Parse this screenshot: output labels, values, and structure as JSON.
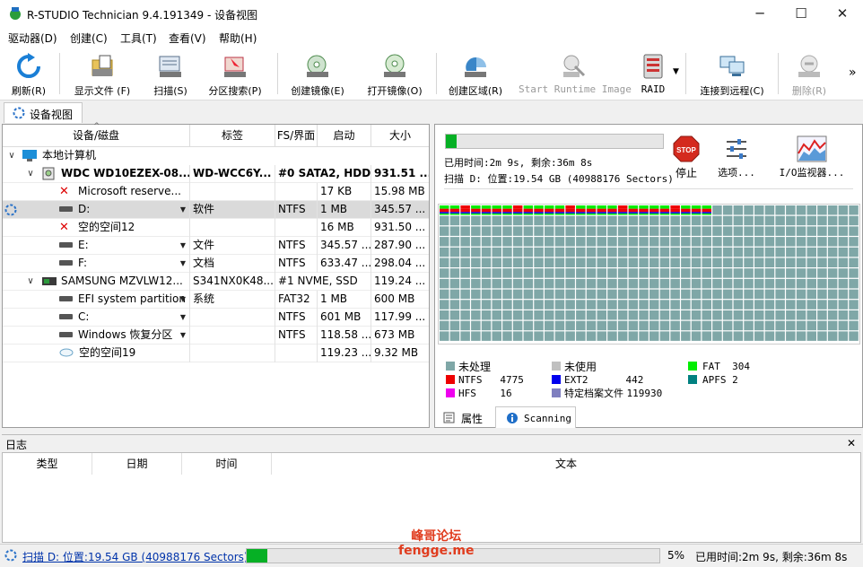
{
  "window": {
    "title": "R-STUDIO Technician 9.4.191349 - 设备视图",
    "minimize_glyph": "─",
    "maximize_glyph": "☐",
    "close_glyph": "✕"
  },
  "menu": [
    "驱动器(D)",
    "创建(C)",
    "工具(T)",
    "查看(V)",
    "帮助(H)"
  ],
  "toolbar": {
    "refresh": "刷新(R)",
    "show_files": "显示文件 (F)",
    "scan": "扫描(S)",
    "partition_search": "分区搜索(P)",
    "create_image": "创建镜像(E)",
    "open_image": "打开镜像(O)",
    "create_region": "创建区域(R)",
    "start_runtime": "Start Runtime Image",
    "raid": "RAID",
    "connect_remote": "连接到远程(C)",
    "delete": "删除(R)",
    "more": "»"
  },
  "view_tab": "设备视图",
  "tree": {
    "headers": [
      "设备/磁盘",
      "标签",
      "FS/界面",
      "启动",
      "大小"
    ],
    "root": "本地计算机",
    "rows": [
      {
        "name": "WDC WD10EZEX-08...",
        "label": "WD-WCC6Y...",
        "fs": "#0 SATA2, HDD",
        "start": "",
        "size": "931.51 ..."
      },
      {
        "name": "Microsoft reserve...",
        "label": "",
        "fs": "",
        "start": "17 KB",
        "size": "15.98 MB"
      },
      {
        "name": "D:",
        "label": "软件",
        "fs": "NTFS",
        "start": "1 MB",
        "size": "345.57 ..."
      },
      {
        "name": "空的空间12",
        "label": "",
        "fs": "",
        "start": "16 MB",
        "size": "931.50 ..."
      },
      {
        "name": "E:",
        "label": "文件",
        "fs": "NTFS",
        "start": "345.57 ...",
        "size": "287.90 ..."
      },
      {
        "name": "F:",
        "label": "文档",
        "fs": "NTFS",
        "start": "633.47 ...",
        "size": "298.04 ..."
      },
      {
        "name": "SAMSUNG MZVLW12...",
        "label": "S341NX0K48...",
        "fs": "#1 NVME, SSD",
        "start": "",
        "size": "119.24 ..."
      },
      {
        "name": "EFI system partition",
        "label": "系统",
        "fs": "FAT32",
        "start": "1 MB",
        "size": "600 MB"
      },
      {
        "name": "C:",
        "label": "",
        "fs": "NTFS",
        "start": "601 MB",
        "size": "117.99 ..."
      },
      {
        "name": "Windows 恢复分区",
        "label": "",
        "fs": "NTFS",
        "start": "118.58 ...",
        "size": "673 MB"
      },
      {
        "name": "空的空间19",
        "label": "",
        "fs": "",
        "start": "119.23 ...",
        "size": "9.32 MB"
      }
    ]
  },
  "scan": {
    "progress_fraction": 0.05,
    "line1": "已用时间:2m 9s, 剩余:36m 8s",
    "line2": "扫描 D: 位置:19.54 GB (40988176 Sectors)",
    "stop": "停止",
    "stop_sign": "STOP",
    "options": "选项...",
    "io_monitor": "I/O监视器...",
    "map_cells_total": 760,
    "map_cells_scanned": 26,
    "legend": [
      {
        "name": "未处理",
        "count": "",
        "color": "#7fa7a7"
      },
      {
        "name": "未使用",
        "count": "",
        "color": "#c0c0c0"
      },
      {
        "name": "FAT",
        "count": "304",
        "color": "#00ee00"
      },
      {
        "name": "NTFS",
        "count": "4775",
        "color": "#ee0000"
      },
      {
        "name": "EXT2",
        "count": "442",
        "color": "#0000ee"
      },
      {
        "name": "APFS",
        "count": "2",
        "color": "#008080"
      },
      {
        "name": "HFS",
        "count": "16",
        "color": "#ee00ee"
      },
      {
        "name": "特定档案文件",
        "count": "119930",
        "color": "#7f7fbf"
      }
    ]
  },
  "right_tabs": {
    "properties": "属性",
    "scanning": "Scanning"
  },
  "log": {
    "title": "日志",
    "close": "✕",
    "headers": [
      "类型",
      "日期",
      "时间",
      "文本"
    ]
  },
  "status": {
    "text": "扫描 D: 位置:19.54 GB (40988176 Sectors)",
    "percent": "5%",
    "progress_fraction": 0.05,
    "time": "已用时间:2m 9s, 剩余:36m 8s"
  },
  "watermark": {
    "line1": "峰哥论坛",
    "line2": "fengge.me"
  }
}
